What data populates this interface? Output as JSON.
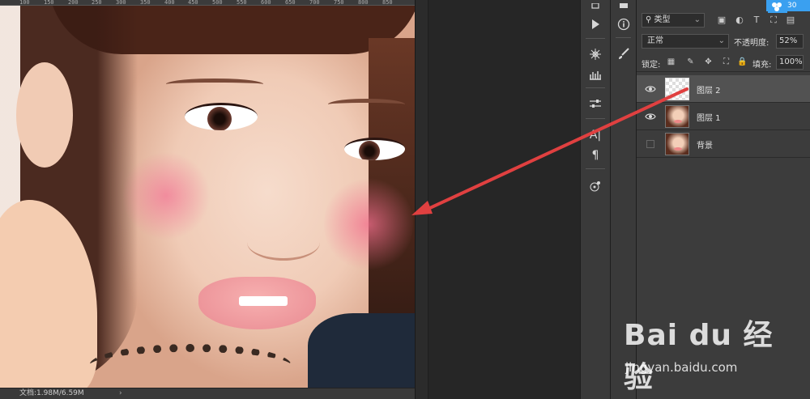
{
  "ruler": {
    "ticks": [
      "100",
      "150",
      "200",
      "250",
      "300",
      "350",
      "400",
      "450",
      "500",
      "550",
      "600",
      "650",
      "700",
      "750",
      "800",
      "850"
    ]
  },
  "statusbar": {
    "doc_info": "文档:1.98M/6.59M",
    "arrow": "›"
  },
  "layers_panel": {
    "filter_label": "类型",
    "blend_mode": "正常",
    "opacity_label": "不透明度:",
    "opacity_value": "52%",
    "lock_label": "锁定:",
    "fill_label": "填充:",
    "fill_value": "100%",
    "layers": [
      {
        "name": "图层 2",
        "visible": true,
        "selected": true,
        "thumb": "transparent"
      },
      {
        "name": "图层 1",
        "visible": true,
        "selected": false,
        "thumb": "photo"
      },
      {
        "name": "背景",
        "visible": false,
        "selected": false,
        "thumb": "photo"
      }
    ]
  },
  "badge": {
    "text": "30"
  },
  "watermark": {
    "logo": "Bai du 经验",
    "url": "jingyan.baidu.com"
  },
  "colors": {
    "annotation_arrow": "#e04040",
    "panel_bg": "#3c3c3c",
    "selected_layer": "#525252",
    "badge": "#3aa0f0"
  }
}
